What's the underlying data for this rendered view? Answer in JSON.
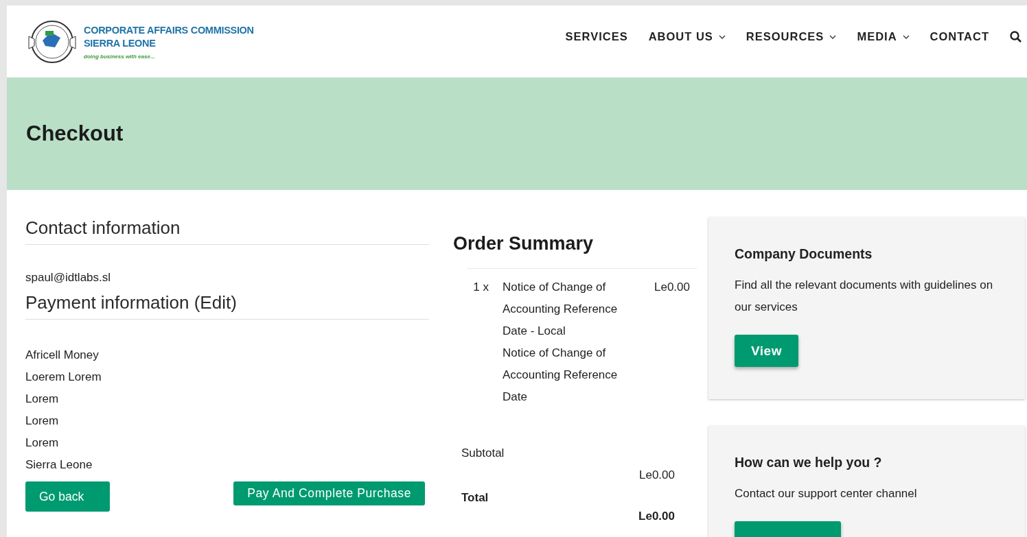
{
  "header": {
    "logo": {
      "line1": "CORPORATE AFFAIRS COMMISSION",
      "line2": "SIERRA LEONE",
      "tagline": "doing business with ease..."
    },
    "nav": [
      {
        "label": "SERVICES",
        "dropdown": false
      },
      {
        "label": "ABOUT US",
        "dropdown": true
      },
      {
        "label": "RESOURCES",
        "dropdown": true
      },
      {
        "label": "MEDIA",
        "dropdown": true
      },
      {
        "label": "CONTACT",
        "dropdown": false
      }
    ]
  },
  "banner": {
    "title": "Checkout"
  },
  "contact": {
    "heading": "Contact information",
    "email": "spaul@idtlabs.sl"
  },
  "payment": {
    "heading": "Payment information (Edit)",
    "lines": [
      "Africell Money",
      "Loerem Lorem",
      "Lorem",
      "Lorem",
      "Lorem",
      "Sierra Leone"
    ]
  },
  "buttons": {
    "back": "Go back",
    "pay": "Pay And Complete Purchase"
  },
  "order_summary": {
    "title": "Order Summary",
    "items": [
      {
        "qty": "1 x",
        "name": "Notice of Change of Accounting Reference Date - Local",
        "detail": "Notice of Change of Accounting Reference Date",
        "price": "Le0.00"
      }
    ],
    "subtotal_label": "Subtotal",
    "subtotal": "Le0.00",
    "total_label": "Total",
    "total": "Le0.00"
  },
  "cards": [
    {
      "title": "Company Documents",
      "text": "Find all the relevant documents with guidelines on our services",
      "button": "View"
    },
    {
      "title": "How can we help you ?",
      "text": "Contact our support center channel"
    }
  ]
}
